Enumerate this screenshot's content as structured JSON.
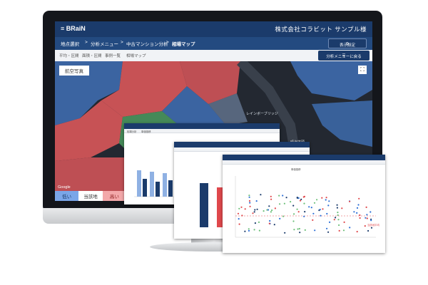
{
  "header": {
    "logo": "BRaiN",
    "company": "株式会社コラビット サンプル様"
  },
  "nav": {
    "items": [
      "地点選択",
      "分析メニュー",
      "中古マンション分析",
      "相場マップ"
    ],
    "separators": [
      ">",
      ">",
      ">"
    ]
  },
  "subnav": {
    "items": [
      "平均・区間",
      "面積・区間",
      "事例一覧",
      "相場マップ"
    ]
  },
  "buttons": {
    "display_settings": "表示設定",
    "back_to_menu": "分析メニューに戻る"
  },
  "map": {
    "layer_button": "航空写真",
    "labels": [
      "レインボーブリッジ",
      "晴海埠頭"
    ],
    "google": "Google",
    "legend": {
      "low": "低い",
      "site": "当該地",
      "high": "高い"
    }
  },
  "colors": {
    "navy": "#1b3b6b",
    "low": "#2d6fd6",
    "high": "#e0484c",
    "site": "#6ec07a"
  },
  "panel1": {
    "tabs": [
      "相場分析",
      "単価推移"
    ]
  },
  "panel3": {
    "title": "単価推移",
    "ref_label": "当該地平均"
  }
}
